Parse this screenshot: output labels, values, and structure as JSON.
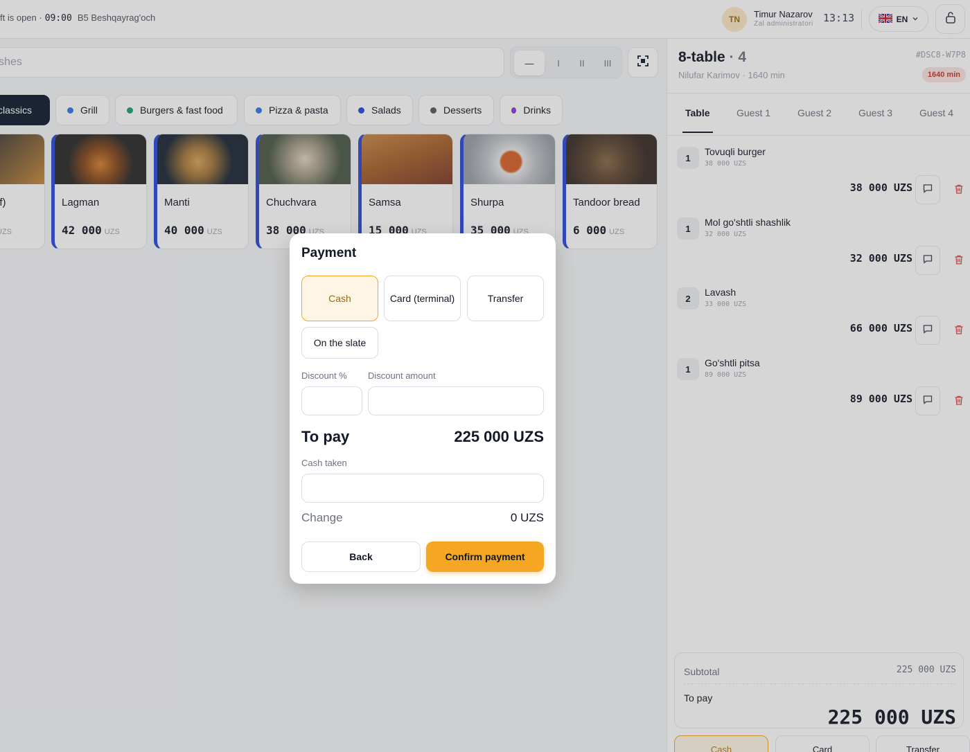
{
  "header": {
    "shift_status": "ft is open ·",
    "shift_time": "09:00",
    "location": "B5 Beshqayrag'och",
    "user_initials": "TN",
    "user_name": "Timur Nazarov",
    "user_role": "Zal administratori",
    "clock": "13:13",
    "language": "EN"
  },
  "search": {
    "placeholder": "lishes"
  },
  "density": {
    "options": [
      "—",
      "I",
      "II",
      "III"
    ],
    "selected": "—"
  },
  "categories": [
    {
      "label": "classics",
      "active": true,
      "dot": ""
    },
    {
      "label": "Grill",
      "active": false,
      "dot": "#2c7be5"
    },
    {
      "label": "Burgers & fast food",
      "active": false,
      "dot": "#1f9d74"
    },
    {
      "label": "Pizza & pasta",
      "active": false,
      "dot": "#2c7be5"
    },
    {
      "label": "Salads",
      "active": false,
      "dot": "#2c4bd6"
    },
    {
      "label": "Desserts",
      "active": false,
      "dot": "#555b66"
    },
    {
      "label": "Drinks",
      "active": false,
      "dot": "#8a3fd1"
    }
  ],
  "dishes": [
    {
      "name": "af)",
      "price": "",
      "currency": "UZS",
      "image_colors": [
        "#3a3a3a",
        "#c98a3b"
      ]
    },
    {
      "name": "Lagman",
      "price": "42 000",
      "currency": "UZS",
      "image_colors": [
        "#2b2b2b",
        "#d6822e"
      ]
    },
    {
      "name": "Manti",
      "price": "40 000",
      "currency": "UZS",
      "image_colors": [
        "#1e2a36",
        "#d8a45c"
      ]
    },
    {
      "name": "Chuchvara",
      "price": "38 000",
      "currency": "UZS",
      "image_colors": [
        "#4d5a48",
        "#e0d6c2"
      ]
    },
    {
      "name": "Samsa",
      "price": "15 000",
      "currency": "UZS",
      "image_colors": [
        "#7d3b2a",
        "#c98a4b"
      ]
    },
    {
      "name": "Shurpa",
      "price": "35 000",
      "currency": "UZS",
      "image_colors": [
        "#bfc3c8",
        "#d9622b"
      ]
    },
    {
      "name": "Tandoor bread",
      "price": "6 000",
      "currency": "UZS",
      "image_colors": [
        "#3b2f28",
        "#8c6a4a"
      ]
    }
  ],
  "order": {
    "title": "8-table",
    "guests": "· 4",
    "subtitle": "Nilufar Karimov · 1640 min",
    "code": "#DSC8-W7P8",
    "timer": "1640 min",
    "tabs": [
      "Table",
      "Guest 1",
      "Guest 2",
      "Guest 3",
      "Guest 4"
    ],
    "active_tab": "Table",
    "items": [
      {
        "qty": "1",
        "name": "Tovuqli burger",
        "unit_price": "38 000 UZS",
        "total": "38 000 UZS"
      },
      {
        "qty": "1",
        "name": "Mol go'shtli shashlik",
        "unit_price": "32 000 UZS",
        "total": "32 000 UZS"
      },
      {
        "qty": "2",
        "name": "Lavash",
        "unit_price": "33 000 UZS",
        "total": "66 000 UZS"
      },
      {
        "qty": "1",
        "name": "Go'shtli pitsa",
        "unit_price": "89 000 UZS",
        "total": "89 000 UZS"
      }
    ],
    "subtotal_label": "Subtotal",
    "subtotal": "225 000 UZS",
    "to_pay_label": "To pay",
    "to_pay": "225 000 UZS",
    "pay_methods": [
      "Cash",
      "Card",
      "Transfer"
    ],
    "active_pay_method": "Cash"
  },
  "payment_modal": {
    "title": "Payment",
    "methods": [
      "Cash",
      "Card (terminal)",
      "Transfer",
      "On the slate"
    ],
    "selected_method": "Cash",
    "discount_percent_label": "Discount %",
    "discount_percent_value": "",
    "discount_amount_label": "Discount amount",
    "discount_amount_value": "",
    "to_pay_label": "To pay",
    "to_pay_value": "225 000 UZS",
    "cash_taken_label": "Cash taken",
    "cash_taken_value": "",
    "change_label": "Change",
    "change_value": "0 UZS",
    "back_label": "Back",
    "confirm_label": "Confirm payment"
  },
  "colors": {
    "accent": "#f5a623",
    "dark": "#0f1b2d",
    "dish_stripe": "#2c4bd6",
    "danger": "#d64545"
  }
}
